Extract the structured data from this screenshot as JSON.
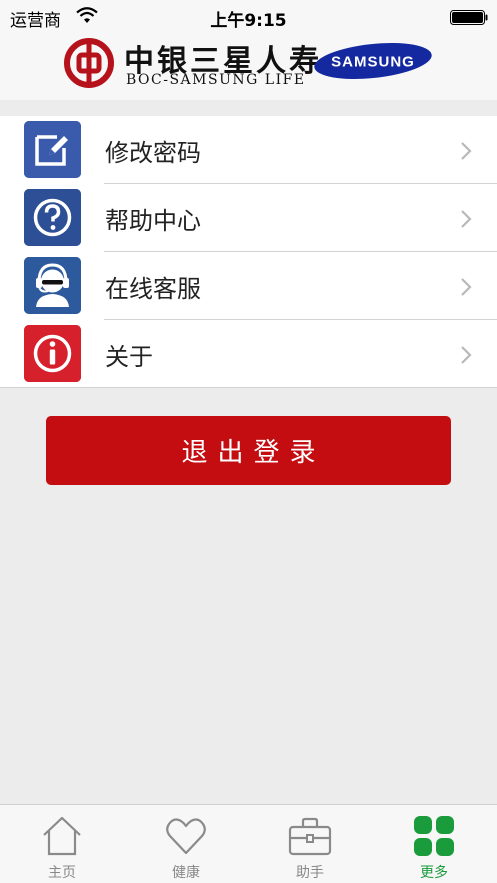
{
  "status_bar": {
    "carrier": "运营商",
    "time": "上午9:15"
  },
  "header": {
    "brand_cn": "中银三星人寿",
    "brand_en": "BOC-SAMSUNG LIFE",
    "partner_logo_text": "SAMSUNG",
    "icons": [
      "boc-logo-icon",
      "samsung-logo-icon"
    ]
  },
  "menu": {
    "items": [
      {
        "label": "修改密码",
        "icon": "edit-icon",
        "icon_color": "#3a5bab"
      },
      {
        "label": "帮助中心",
        "icon": "help-icon",
        "icon_color": "#2c4f95"
      },
      {
        "label": "在线客服",
        "icon": "customer-service-icon",
        "icon_color": "#2c5a9c"
      },
      {
        "label": "关于",
        "icon": "info-icon",
        "icon_color": "#d6202c"
      }
    ]
  },
  "logout": {
    "label": "退出登录",
    "color": "#c30d11"
  },
  "tab_bar": {
    "tabs": [
      {
        "label": "主页",
        "icon": "home-icon",
        "active": false
      },
      {
        "label": "健康",
        "icon": "heart-icon",
        "active": false
      },
      {
        "label": "助手",
        "icon": "briefcase-icon",
        "active": false
      },
      {
        "label": "更多",
        "icon": "grid-icon",
        "active": true
      }
    ],
    "active_color": "#1a9b3c",
    "inactive_color": "#888888"
  }
}
